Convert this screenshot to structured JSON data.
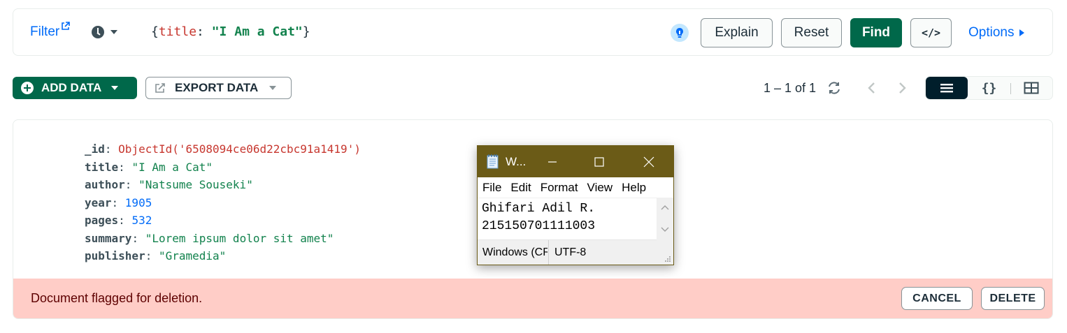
{
  "query_bar": {
    "filter_label": "Filter",
    "query_open": "{",
    "query_key": "title",
    "query_colon": ": ",
    "query_value": "\"I Am a Cat\"",
    "query_close": "}",
    "explain_label": "Explain",
    "reset_label": "Reset",
    "find_label": "Find",
    "code_label": "</>",
    "options_label": "Options"
  },
  "toolbar": {
    "add_data_label": "ADD DATA",
    "export_data_label": "EXPORT DATA",
    "pagination": "1 – 1 of 1",
    "view_json_glyph": "{}"
  },
  "document": {
    "fields": [
      {
        "key": "_id",
        "value": "ObjectId('6508094ce06d22cbc91a1419')",
        "type": "oid"
      },
      {
        "key": "title",
        "value": "\"I Am a Cat\"",
        "type": "str"
      },
      {
        "key": "author",
        "value": "\"Natsume Souseki\"",
        "type": "str"
      },
      {
        "key": "year",
        "value": "1905",
        "type": "num"
      },
      {
        "key": "pages",
        "value": "532",
        "type": "num"
      },
      {
        "key": "summary",
        "value": "\"Lorem ipsum dolor sit amet\"",
        "type": "str"
      },
      {
        "key": "publisher",
        "value": "\"Gramedia\"",
        "type": "str"
      }
    ],
    "colon": ": ",
    "flag_message": "Document flagged for deletion.",
    "cancel_label": "CANCEL",
    "delete_label": "DELETE"
  },
  "notepad": {
    "title": "W...",
    "menu": [
      "File",
      "Edit",
      "Format",
      "View",
      "Help"
    ],
    "text_lines": [
      "Ghifari Adil R.",
      "215150701111003"
    ],
    "status_line_ending": "Windows (CRLF)",
    "status_encoding": "UTF-8"
  },
  "colors": {
    "accent_green": "#00684a",
    "link_blue": "#016bf8",
    "flag_bg": "#ffcdc7",
    "notepad_titlebar": "#6b5b17"
  },
  "icons": {
    "filter_external": "external-link-icon",
    "history": "clock-icon",
    "ai": "lightbulb-icon",
    "add": "plus-circle-icon",
    "export": "export-icon",
    "refresh": "refresh-icon",
    "prev": "chevron-left-icon",
    "next": "chevron-right-icon",
    "list_view": "list-view-icon",
    "json_view": "json-view-icon",
    "table_view": "table-view-icon"
  }
}
